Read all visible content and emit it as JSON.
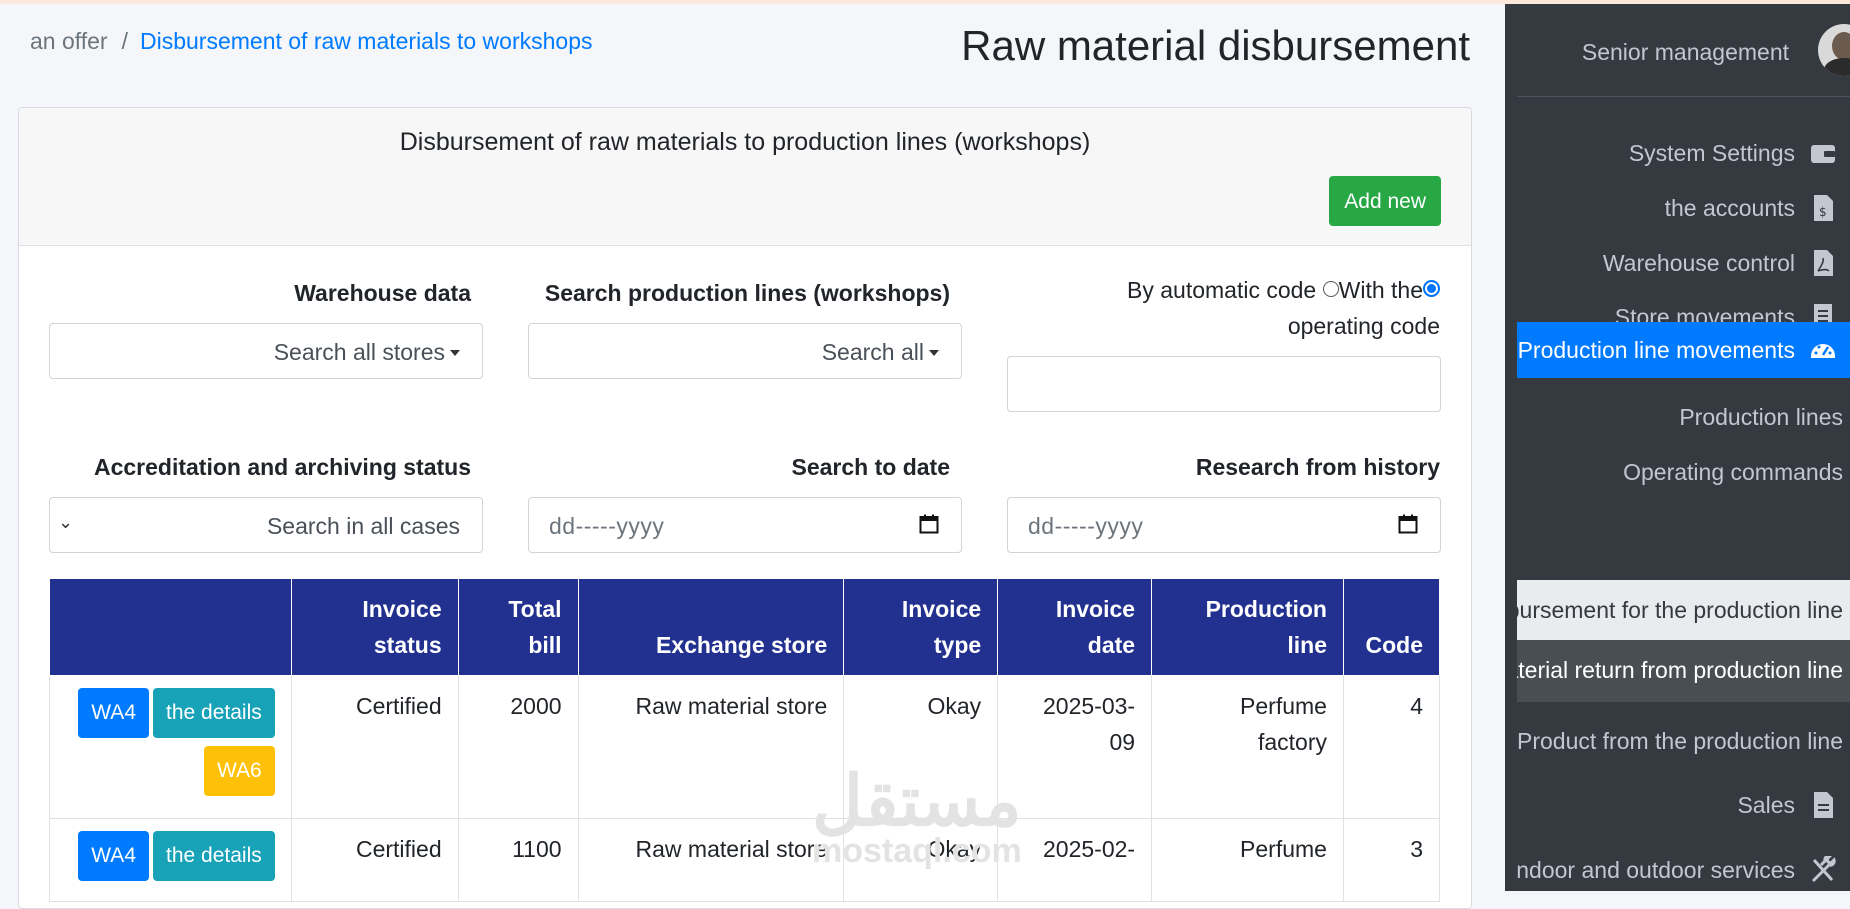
{
  "breadcrumb": {
    "home": "an offer",
    "separator": "/",
    "current": "Disbursement of raw materials to workshops"
  },
  "page_title": "Raw material disbursement",
  "card": {
    "title": "Disbursement of raw materials to production lines (workshops)",
    "add_button": "Add new"
  },
  "filters": {
    "warehouse": {
      "label": "Warehouse data",
      "value": "Search all stores"
    },
    "production_lines": {
      "label": "Search production lines (workshops)",
      "value": "Search all"
    },
    "code": {
      "radio_auto_label": "By automatic code",
      "radio_operating_label_1": "With the",
      "radio_operating_label_2": "operating code",
      "selected": "operating code",
      "value": ""
    },
    "status": {
      "label": "Accreditation and archiving status",
      "value": "Search in all cases"
    },
    "to_date": {
      "label": "Search to date",
      "placeholder": "dd-----yyyy"
    },
    "from_date": {
      "label": "Research from history",
      "placeholder": "dd-----yyyy"
    }
  },
  "table": {
    "headers": {
      "actions": "",
      "status_1": "Invoice",
      "status_2": "status",
      "total_1": "Total",
      "total_2": "bill",
      "store": "Exchange store",
      "type_1": "Invoice",
      "type_2": "type",
      "date_1": "Invoice",
      "date_2": "date",
      "line_1": "Production",
      "line_2": "line",
      "code": "Code"
    },
    "rows": [
      {
        "btn_code": "WA4",
        "btn_details": "the details",
        "btn_code2": "WA6",
        "status": "Certified",
        "total": "2000",
        "store": "Raw material store",
        "type": "Okay",
        "date_1": "2025-03-",
        "date_2": "09",
        "line_1": "Perfume",
        "line_2": "factory",
        "code": "4"
      },
      {
        "btn_code": "WA4",
        "btn_details": "the details",
        "status": "Certified",
        "total": "1100",
        "store": "Raw material store",
        "type": "Okay",
        "date_1": "2025-02-",
        "line_1": "Perfume",
        "code": "3"
      }
    ]
  },
  "sidebar": {
    "user": "Senior management",
    "items": [
      {
        "label": "System Settings",
        "icon": "wallet-icon"
      },
      {
        "label": "the accounts",
        "icon": "invoice-dollar-icon"
      },
      {
        "label": "Warehouse control",
        "icon": "file-pdf-icon"
      },
      {
        "label": "Store movements",
        "icon": "receipt-icon"
      },
      {
        "label": "Production line movements",
        "icon": "tachometer-icon",
        "active": true
      },
      {
        "label": "Production lines"
      },
      {
        "label": "Operating commands"
      },
      {
        "label": "Disbursement for the production line"
      },
      {
        "label": "Material return from production line"
      },
      {
        "label": "Product from the production line"
      },
      {
        "label": "Sales",
        "icon": "file-icon"
      },
      {
        "label": "Indoor and outdoor services",
        "icon": "tools-icon"
      }
    ]
  },
  "watermark": {
    "line1": "مستقل",
    "line2": "mostaql.com"
  },
  "colors": {
    "primary": "#007bff",
    "success": "#28a745",
    "info": "#17a2b8",
    "warning": "#ffc107",
    "table_header": "#22318f",
    "sidebar": "#343a40"
  }
}
